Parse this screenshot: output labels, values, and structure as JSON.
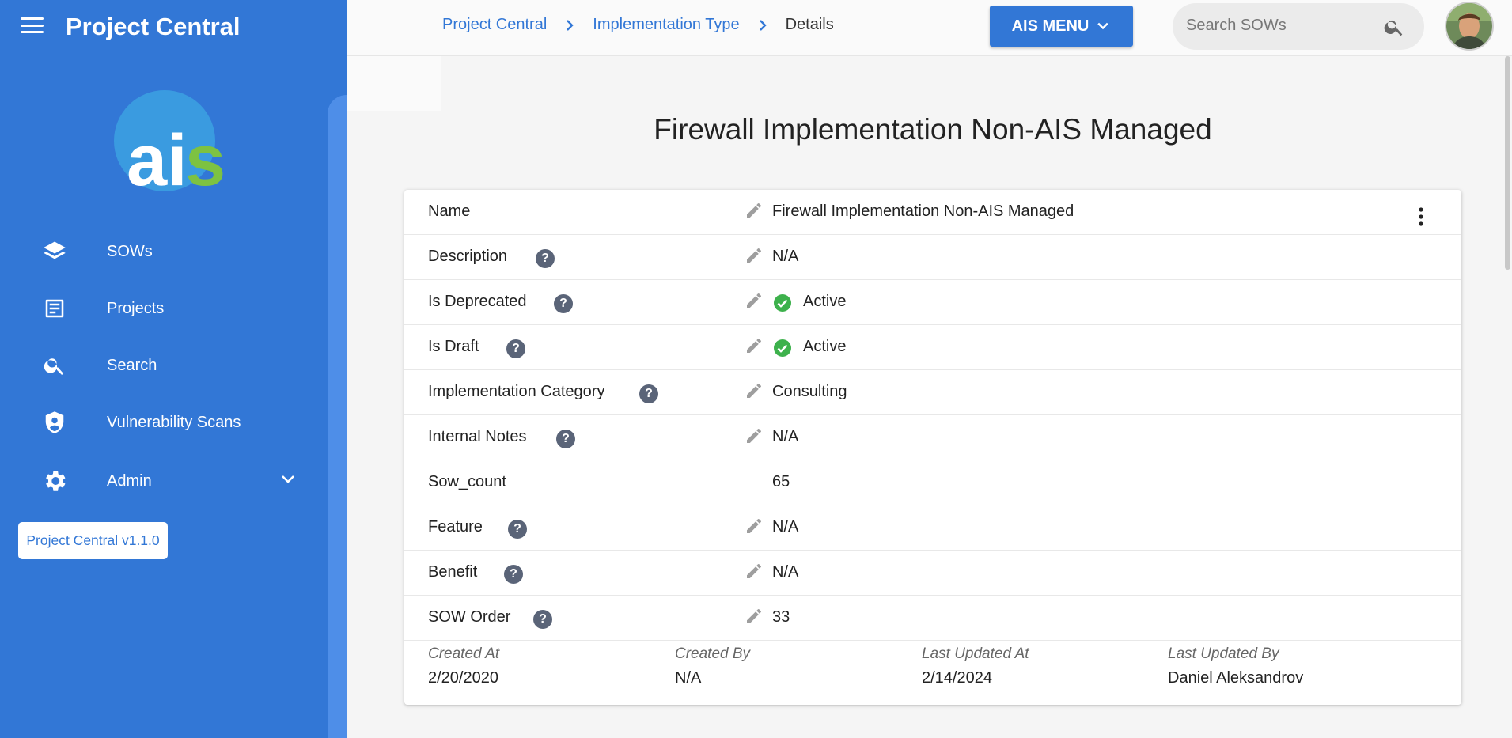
{
  "app": {
    "title": "Project Central",
    "version": "Project Central v1.1.0"
  },
  "sidebar": {
    "items": [
      {
        "label": "SOWs",
        "icon": "layers-icon"
      },
      {
        "label": "Projects",
        "icon": "document-icon"
      },
      {
        "label": "Search",
        "icon": "search-icon"
      },
      {
        "label": "Vulnerability Scans",
        "icon": "shield-icon"
      },
      {
        "label": "Admin",
        "icon": "gear-icon"
      }
    ]
  },
  "header": {
    "breadcrumb": [
      "Project Central",
      "Implementation Type",
      "Details"
    ],
    "menu_label": "AIS MENU",
    "search_placeholder": "Search SOWs"
  },
  "main": {
    "title": "Firewall Implementation Non-AIS Managed",
    "fields": [
      {
        "label": "Name",
        "value": "Firewall Implementation Non-AIS Managed"
      },
      {
        "label": "Description",
        "value": "N/A"
      },
      {
        "label": "Is Deprecated",
        "value": "Active"
      },
      {
        "label": "Is Draft",
        "value": "Active"
      },
      {
        "label": "Implementation Category",
        "value": "Consulting"
      },
      {
        "label": "Internal Notes",
        "value": "N/A"
      },
      {
        "label": "Sow_count",
        "value": "65"
      },
      {
        "label": "Feature",
        "value": "N/A"
      },
      {
        "label": "Benefit",
        "value": "N/A"
      },
      {
        "label": "SOW Order",
        "value": "33"
      }
    ],
    "meta": [
      {
        "label": "Created At",
        "value": "2/20/2020"
      },
      {
        "label": "Created By",
        "value": "N/A"
      },
      {
        "label": "Last Updated At",
        "value": "2/14/2024"
      },
      {
        "label": "Last Updated By",
        "value": "Daniel Aleksandrov"
      }
    ]
  },
  "colors": {
    "brand": "#3277d6",
    "active": "#3db14c",
    "help": "#5a6478"
  }
}
